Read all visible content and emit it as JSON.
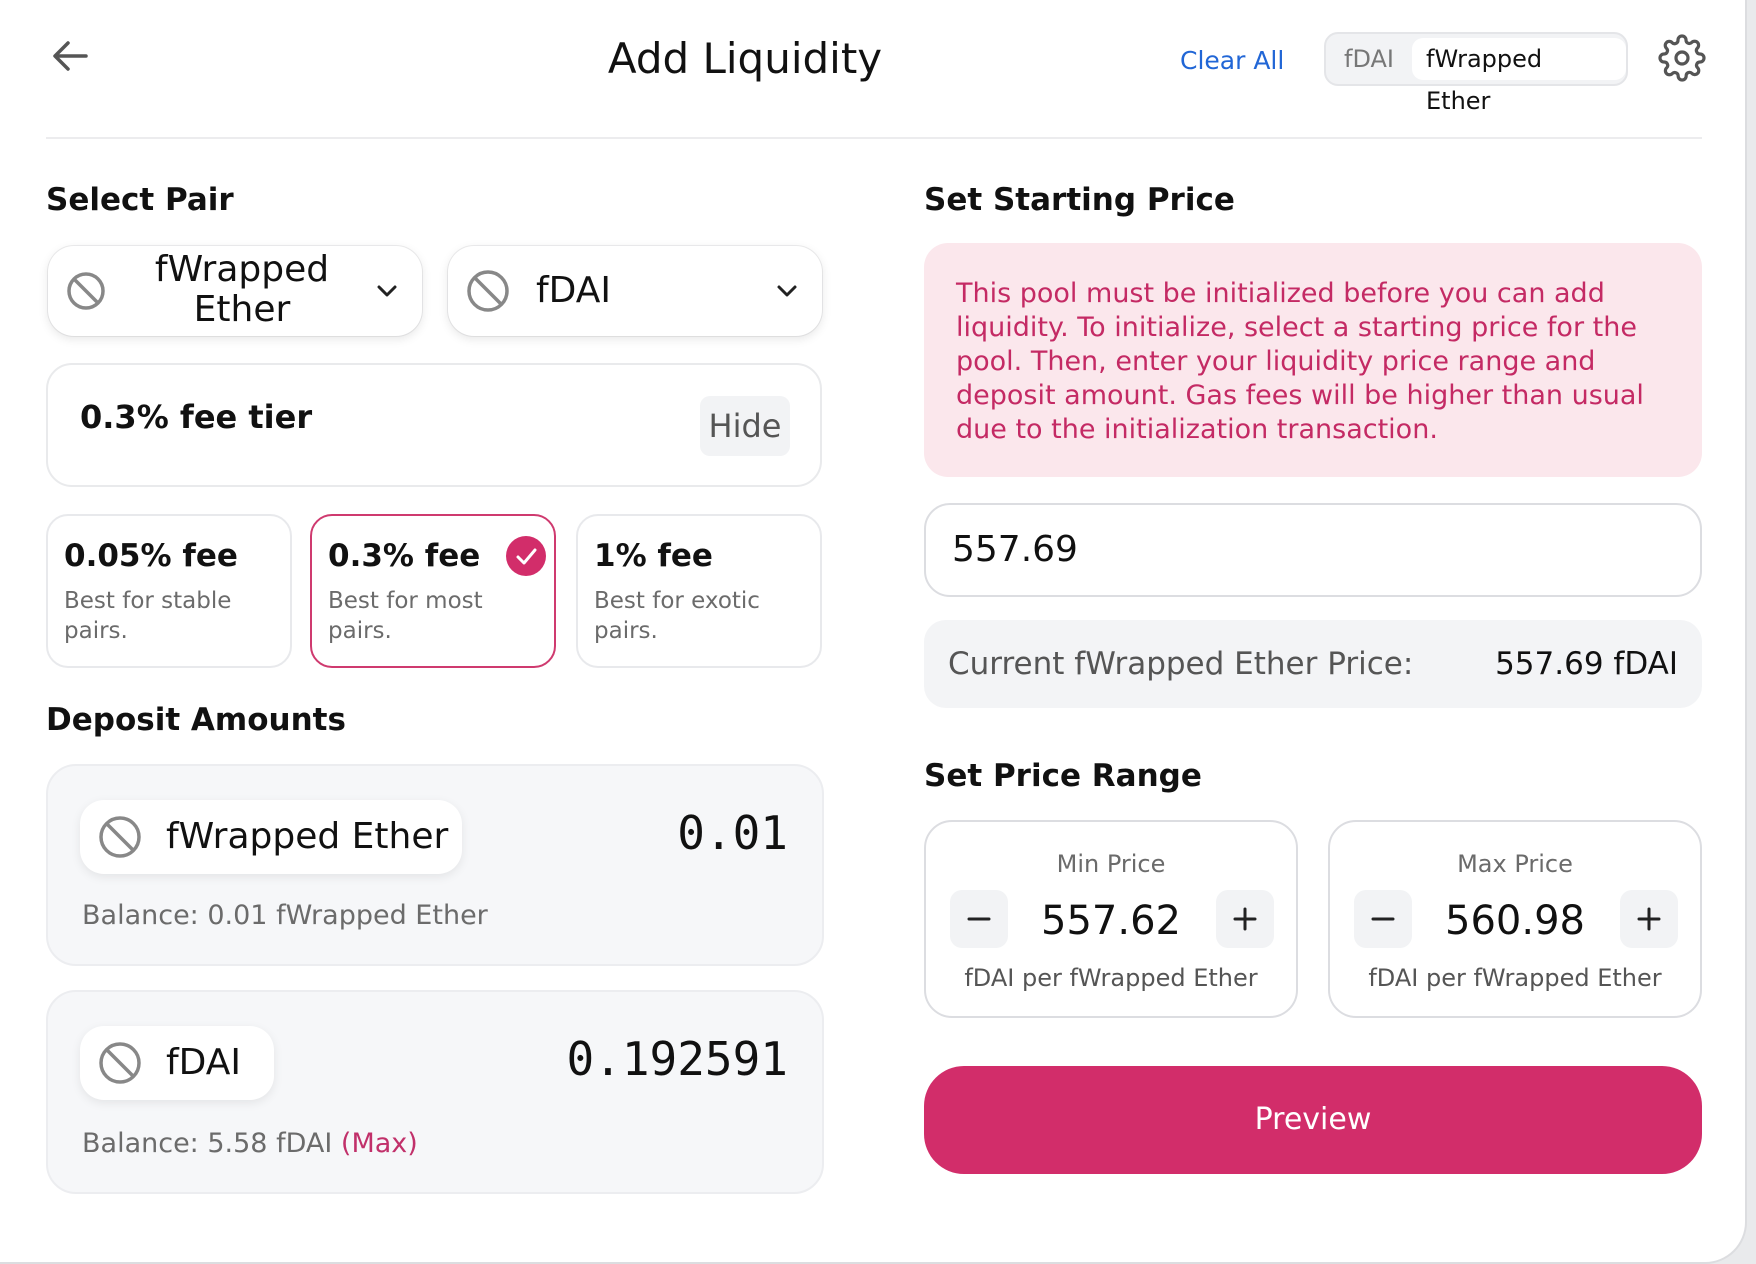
{
  "header": {
    "title": "Add Liquidity",
    "clear_all": "Clear All",
    "token_toggle": [
      "fDAI",
      "fWrapped Ether"
    ],
    "selected_toggle": "fWrapped Ether"
  },
  "select_pair": {
    "title": "Select Pair",
    "token_a": {
      "line1": "fWrapped",
      "line2": "Ether"
    },
    "token_b": "fDAI"
  },
  "fee": {
    "selected_label": "0.3% fee tier",
    "hide_label": "Hide",
    "options": [
      {
        "title": "0.05% fee",
        "desc": "Best for stable pairs."
      },
      {
        "title": "0.3% fee",
        "desc": "Best for most pairs.",
        "selected": true
      },
      {
        "title": "1% fee",
        "desc": "Best for exotic pairs."
      }
    ]
  },
  "deposit": {
    "title": "Deposit Amounts",
    "token_a": {
      "name": "fWrapped Ether",
      "amount": "0.01",
      "balance": "Balance: 0.01 fWrapped Ether"
    },
    "token_b": {
      "name": "fDAI",
      "amount": "0.192591",
      "balance": "Balance: 5.58 fDAI",
      "max_label": "(Max)"
    }
  },
  "starting_price": {
    "title": "Set Starting Price",
    "warning": "This pool must be initialized before you can add liquidity. To initialize, select a starting price for the pool. Then, enter your liquidity price range and deposit amount. Gas fees will be higher than usual due to the initialization transaction.",
    "input_value": "557.69",
    "current_label": "Current fWrapped Ether Price:",
    "current_value": "557.69 fDAI"
  },
  "price_range": {
    "title": "Set Price Range",
    "min": {
      "label": "Min Price",
      "value": "557.62",
      "unit": "fDAI per fWrapped Ether"
    },
    "max": {
      "label": "Max Price",
      "value": "560.98",
      "unit": "fDAI per fWrapped Ether"
    }
  },
  "preview_label": "Preview",
  "colors": {
    "accent": "#d22d6a",
    "link": "#2166d6",
    "warning_bg": "#fbe7ec",
    "warning_text": "#c42a64"
  },
  "icons": [
    "back-arrow-icon",
    "gear-icon",
    "ban-icon",
    "chevron-down-icon",
    "check-icon",
    "minus-icon",
    "plus-icon"
  ]
}
